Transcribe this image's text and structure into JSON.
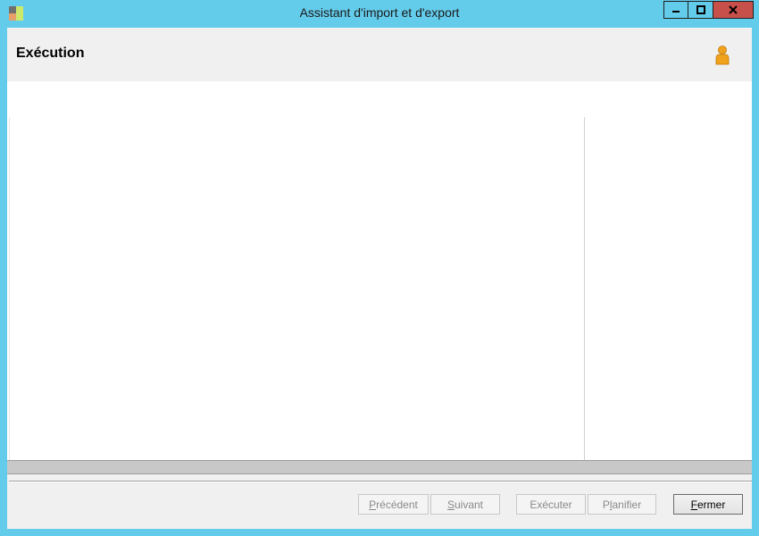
{
  "window": {
    "title": "Assistant d'import et d'export",
    "controls": {
      "minimize": "–",
      "maximize": "□",
      "close": "X"
    }
  },
  "header": {
    "title": "Exécution",
    "help_icon": "person-icon"
  },
  "buttons": {
    "previous": {
      "accel": "P",
      "rest": "récédent",
      "enabled": false
    },
    "next": {
      "accel": "S",
      "rest": "uivant",
      "enabled": false
    },
    "execute": {
      "label": "Exécuter",
      "enabled": false
    },
    "schedule": {
      "pre": "P",
      "accel": "l",
      "rest": "anifier",
      "enabled": false
    },
    "close": {
      "accel": "F",
      "rest": "ermer",
      "enabled": true
    }
  },
  "colors": {
    "titlebar": "#64cceb",
    "close_button": "#c7504b",
    "dialog_background": "#f0f0f0",
    "progress_bar": "#c8c8c8"
  }
}
